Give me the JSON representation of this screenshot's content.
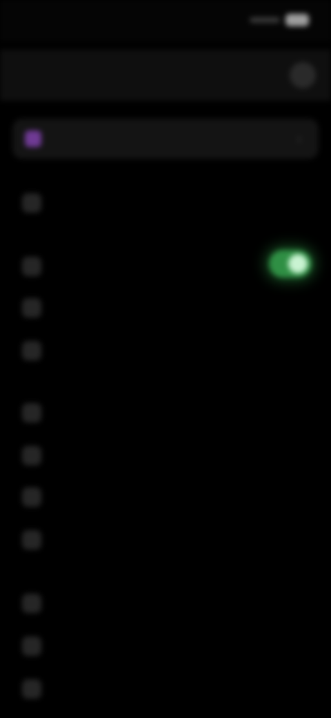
{
  "status_bar": {
    "time": "",
    "icons": [
      "signal-icon",
      "wifi-icon",
      "battery-icon"
    ]
  },
  "app_bar": {
    "title": "",
    "action_icon": "more-icon"
  },
  "banner": {
    "label": "",
    "icon": "account-icon",
    "chevron": "›",
    "accent": "#9b6cc7"
  },
  "settings": {
    "items": [
      {
        "label": "",
        "value": ""
      },
      {
        "label": "",
        "value": "",
        "toggle": true,
        "toggle_on": true,
        "toggle_color": "#2f8f44"
      },
      {
        "label": "",
        "value": ""
      },
      {
        "label": "",
        "value": ""
      },
      {
        "label": "",
        "value": ""
      },
      {
        "label": "",
        "value": ""
      },
      {
        "label": "",
        "value": ""
      },
      {
        "label": "",
        "value": ""
      },
      {
        "label": "",
        "value": ""
      },
      {
        "label": "",
        "value": ""
      },
      {
        "label": "",
        "value": ""
      }
    ]
  },
  "colors": {
    "background": "#000000",
    "appbar": "#0f0f0f",
    "banner": "#141414",
    "toggle_on": "#2f8f44"
  }
}
